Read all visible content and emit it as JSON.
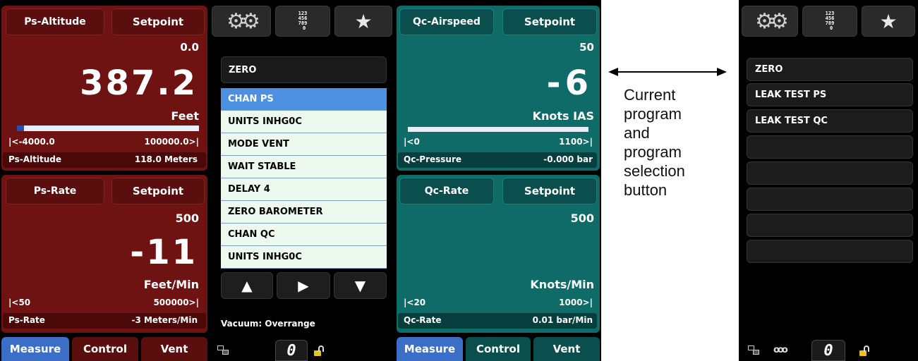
{
  "colors": {
    "red_panel": "#6e1212",
    "teal_panel": "#0f6b68",
    "selected_item": "#4d8fe0",
    "tab_active": "#3b6fc7"
  },
  "toolbar_icons": [
    "gear-icon",
    "keypad-icon",
    "star-icon"
  ],
  "keypad_glyph": "123\n456\n789\n 0",
  "left": {
    "top_panel": {
      "label": "Ps-Altitude",
      "setpoint_label": "Setpoint",
      "setpoint_value": "0.0",
      "reading": "387.2",
      "units": "Feet",
      "range_min": "|<-4000.0",
      "range_max": "100000.0>|",
      "secondary_label": "Ps-Altitude",
      "secondary_value": "118.0 Meters",
      "bar_fill": 0.04
    },
    "bottom_panel": {
      "label": "Ps-Rate",
      "setpoint_label": "Setpoint",
      "setpoint_value": "500",
      "reading": "-11",
      "units": "Feet/Min",
      "range_min": "|<50",
      "range_max": "500000>|",
      "secondary_label": "Ps-Rate",
      "secondary_value": "-3 Meters/Min"
    },
    "tabs": [
      "Measure",
      "Control",
      "Vent"
    ]
  },
  "program": {
    "zero_button": "ZERO",
    "items": [
      "CHAN PS",
      "UNITS INHG0C",
      "MODE VENT",
      "WAIT STABLE",
      "DELAY 4",
      "ZERO BAROMETER",
      "CHAN QC",
      "UNITS INHG0C"
    ],
    "selected_index": 0,
    "status": "Vacuum: Overrange",
    "counter": "0"
  },
  "mid": {
    "top_panel": {
      "label": "Qc-Airspeed",
      "setpoint_label": "Setpoint",
      "setpoint_value": "50",
      "reading": "-6",
      "units": "Knots IAS",
      "range_min": "|<0",
      "range_max": "1100>|",
      "secondary_label": "Qc-Pressure",
      "secondary_value": "-0.000 bar",
      "bar_fill": 0.0
    },
    "bottom_panel": {
      "label": "Qc-Rate",
      "setpoint_label": "Setpoint",
      "setpoint_value": "500",
      "units": "Knots/Min",
      "range_min": "|<20",
      "range_max": "1000>|",
      "secondary_label": "Qc-Rate",
      "secondary_value": "0.01 bar/Min"
    },
    "tabs": [
      "Measure",
      "Control",
      "Vent"
    ]
  },
  "annotation": "Current\nprogram\nand\nprogram\nselection\nbutton",
  "right": {
    "items": [
      "ZERO",
      "LEAK TEST PS",
      "LEAK TEST QC",
      "",
      "",
      "",
      "",
      ""
    ],
    "counter": "0"
  }
}
